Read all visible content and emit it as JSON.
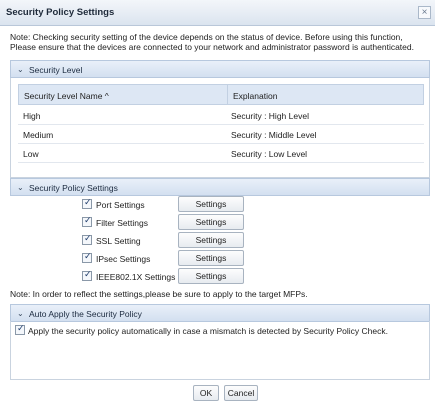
{
  "window": {
    "title": "Security Policy Settings",
    "close_glyph": "×"
  },
  "note_top": "Note: Checking security setting of the device depends on the status of device. Before using this function, Please ensure that the devices are connected to your network and administrator password is authenticated.",
  "security_level": {
    "header": "Security Level",
    "columns": [
      "Security Level Name ^",
      "Explanation"
    ],
    "rows": [
      {
        "name": "High",
        "explanation": "Security : High Level"
      },
      {
        "name": "Medium",
        "explanation": "Security : Middle Level"
      },
      {
        "name": "Low",
        "explanation": "Security : Low Level"
      }
    ]
  },
  "policy_settings": {
    "header": "Security Policy Settings",
    "items": [
      {
        "label": "Port Settings",
        "checked": true,
        "button": "Settings"
      },
      {
        "label": "Filter Settings",
        "checked": true,
        "button": "Settings"
      },
      {
        "label": "SSL Setting",
        "checked": true,
        "button": "Settings"
      },
      {
        "label": "IPsec Settings",
        "checked": true,
        "button": "Settings"
      },
      {
        "label": "IEEE802.1X Settings",
        "checked": true,
        "button": "Settings"
      }
    ],
    "note": "Note: In order to reflect the settings,please be sure to apply to the target MFPs."
  },
  "auto_apply": {
    "header": "Auto Apply the Security Policy",
    "checkbox_label": "Apply the security policy automatically in case a mismatch is detected by Security Policy Check.",
    "checked": true
  },
  "footer": {
    "ok": "OK",
    "cancel": "Cancel"
  },
  "colors": {
    "section_header": "#d3e0f0",
    "table_header": "#dde7f4",
    "border": "#b7c8de"
  },
  "icons": {
    "section_toggle": "chevron-down-icon",
    "close": "close-icon",
    "check": "checkmark-icon"
  }
}
